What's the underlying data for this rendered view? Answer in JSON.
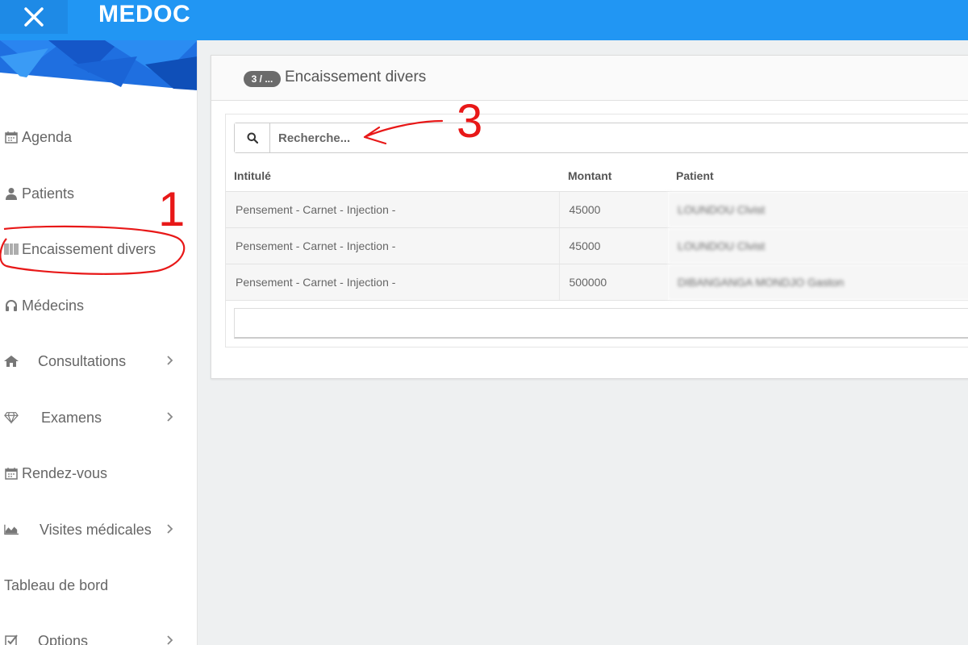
{
  "app": {
    "title": "MEDOC"
  },
  "sidebar": {
    "items": [
      {
        "label": "Agenda",
        "icon": "calendar-icon"
      },
      {
        "label": "Patients",
        "icon": "user-icon"
      },
      {
        "label": "Encaissement divers",
        "icon": "barcode-icon"
      },
      {
        "label": "Médecins",
        "icon": "headphones-icon"
      },
      {
        "label": "Consultations",
        "icon": "home-icon",
        "has_children": true
      },
      {
        "label": "Examens",
        "icon": "diamond-icon",
        "has_children": true
      },
      {
        "label": "Rendez-vous",
        "icon": "calendar-icon"
      },
      {
        "label": "Visites médicales",
        "icon": "area-chart-icon",
        "has_children": true
      },
      {
        "label": "Tableau de bord",
        "icon": ""
      },
      {
        "label": "Options",
        "icon": "checkbox-icon",
        "has_children": true
      }
    ]
  },
  "panel": {
    "badge": "3 / ...",
    "title": "Encaissement divers"
  },
  "search": {
    "placeholder": "Recherche..."
  },
  "table": {
    "headers": [
      "Intitulé",
      "Montant",
      "Patient"
    ],
    "rows": [
      {
        "intitule": "Pensement - Carnet - Injection -",
        "montant": "45000",
        "patient": "LOUNDOU Clvist"
      },
      {
        "intitule": "Pensement - Carnet - Injection -",
        "montant": "45000",
        "patient": "LOUNDOU Clvist"
      },
      {
        "intitule": "Pensement - Carnet - Injection -",
        "montant": "500000",
        "patient": "DIBANGANGA MONDJO Gaston"
      }
    ]
  },
  "annotations": {
    "label_1": "1",
    "label_3": "3"
  },
  "colors": {
    "topbar": "#2196f3",
    "annotation": "#e81818"
  }
}
